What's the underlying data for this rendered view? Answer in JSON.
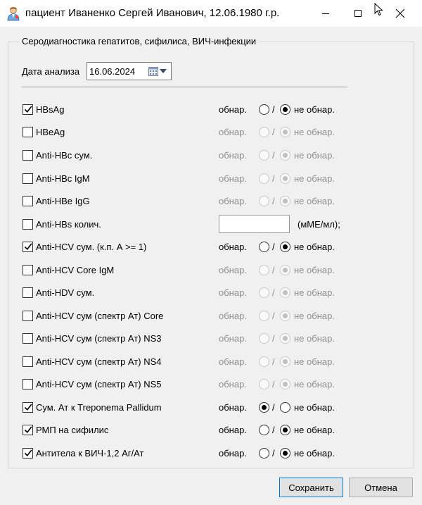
{
  "window": {
    "title": "пациент Иваненко Сергей Иванович, 12.06.1980 г.р.",
    "icons": [
      "user-doctor-icon",
      "minimize-icon",
      "maximize-icon",
      "close-icon",
      "cursor-icon"
    ]
  },
  "group": {
    "title": "Серодиагностика гепатитов, сифилиса, ВИЧ-инфекции"
  },
  "date": {
    "label": "Дата анализа",
    "value": "16.06.2024"
  },
  "labels": {
    "detected": "обнар.",
    "slash": "/",
    "not_detected": "не обнар.",
    "unit": "(мМЕ/мл);"
  },
  "tests": [
    {
      "label": "HBsAg",
      "checked": true,
      "result": "not_detected"
    },
    {
      "label": "HBeAg",
      "checked": false,
      "result": "not_detected"
    },
    {
      "label": "Anti-HBc сум.",
      "checked": false,
      "result": "not_detected"
    },
    {
      "label": "Anti-HBc IgM",
      "checked": false,
      "result": "not_detected"
    },
    {
      "label": "Anti-HBe IgG",
      "checked": false,
      "result": "not_detected"
    },
    {
      "label": "Anti-HBs колич.",
      "checked": false,
      "quantity_value": ""
    },
    {
      "label": "Anti-HCV сум. (к.п. А >= 1)",
      "checked": true,
      "result": "not_detected"
    },
    {
      "label": "Anti-HCV Core IgM",
      "checked": false,
      "result": "not_detected"
    },
    {
      "label": "Anti-HDV сум.",
      "checked": false,
      "result": "not_detected"
    },
    {
      "label": "Anti-HCV сум (спектр Ат) Core",
      "checked": false,
      "result": "not_detected"
    },
    {
      "label": "Anti-HCV сум (спектр Ат) NS3",
      "checked": false,
      "result": "not_detected"
    },
    {
      "label": "Anti-HCV сум (спектр Ат) NS4",
      "checked": false,
      "result": "not_detected"
    },
    {
      "label": "Anti-HCV сум (спектр Ат) NS5",
      "checked": false,
      "result": "not_detected"
    },
    {
      "label": "Сум. Ат к Treponema Pallidum",
      "checked": true,
      "result": "detected"
    },
    {
      "label": "РМП на сифилис",
      "checked": true,
      "result": "not_detected"
    },
    {
      "label": "Антитела к ВИЧ-1,2 Аг/Ат",
      "checked": true,
      "result": "not_detected"
    }
  ],
  "buttons": {
    "save": "Сохранить",
    "cancel": "Отмена"
  },
  "colors": {
    "focus_border": "#0078d7",
    "disabled_text": "#8f8f8f"
  }
}
